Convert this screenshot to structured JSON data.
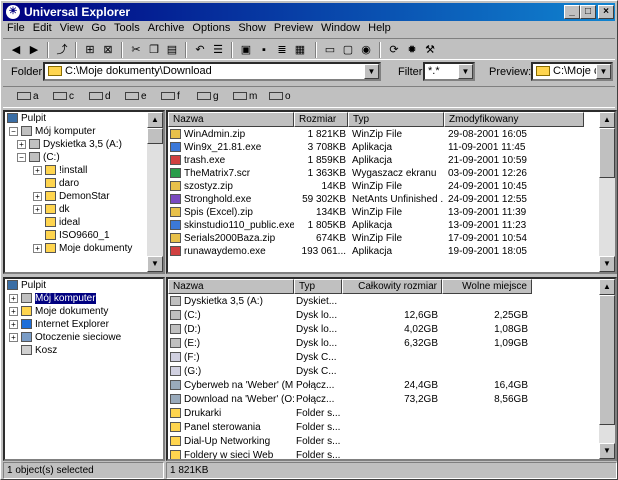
{
  "title": "Universal Explorer",
  "menu": [
    "File",
    "Edit",
    "View",
    "Go",
    "Tools",
    "Archive",
    "Options",
    "Show",
    "Preview",
    "Window",
    "Help"
  ],
  "address": {
    "label": "Folder:",
    "value": "C:\\Moje dokumenty\\Download",
    "filter_label": "Filter:",
    "filter_value": "*.*",
    "preview_label": "Preview:",
    "preview_value": "C:\\Moje do"
  },
  "drives": [
    "a",
    "c",
    "d",
    "e",
    "f",
    "g",
    "m",
    "o"
  ],
  "top_tree": {
    "header": "Pulpit",
    "items": [
      {
        "label": "Mój komputer"
      },
      {
        "label": "Dyskietka 3,5 (A:)"
      },
      {
        "label": "(C:)"
      },
      {
        "label": "!install"
      },
      {
        "label": "daro"
      },
      {
        "label": "DemonStar"
      },
      {
        "label": "dk"
      },
      {
        "label": "ideal"
      },
      {
        "label": "ISO9660_1"
      },
      {
        "label": "Moje dokumenty"
      }
    ]
  },
  "files": {
    "headers": [
      "Nazwa",
      "Rozmiar",
      "Typ",
      "Zmodyfikowany"
    ],
    "rows": [
      {
        "name": "WinAdmin.zip",
        "size": "1 821KB",
        "type": "WinZip File",
        "date": "29-08-2001 16:05"
      },
      {
        "name": "Win9x_21.81.exe",
        "size": "3 708KB",
        "type": "Aplikacja",
        "date": "11-09-2001 11:45"
      },
      {
        "name": "trash.exe",
        "size": "1 859KB",
        "type": "Aplikacja",
        "date": "21-09-2001 10:59"
      },
      {
        "name": "TheMatrix7.scr",
        "size": "1 363KB",
        "type": "Wygaszacz ekranu",
        "date": "03-09-2001 12:26"
      },
      {
        "name": "szostyz.zip",
        "size": "14KB",
        "type": "WinZip File",
        "date": "24-09-2001 10:45"
      },
      {
        "name": "Stronghold.exe",
        "size": "59 302KB",
        "type": "NetAnts Unfinished ...",
        "date": "24-09-2001 12:55"
      },
      {
        "name": "Spis (Excel).zip",
        "size": "134KB",
        "type": "WinZip File",
        "date": "13-09-2001 11:39"
      },
      {
        "name": "skinstudio110_public.exe",
        "size": "1 805KB",
        "type": "Aplikacja",
        "date": "13-09-2001 11:23"
      },
      {
        "name": "Serials2000Baza.zip",
        "size": "674KB",
        "type": "WinZip File",
        "date": "17-09-2001 10:54"
      },
      {
        "name": "runawaydemo.exe",
        "size": "193 061...",
        "type": "Aplikacja",
        "date": "19-09-2001 18:05"
      }
    ]
  },
  "bottom_tree": {
    "header": "Pulpit",
    "items": [
      {
        "label": "Mój komputer"
      },
      {
        "label": "Moje dokumenty"
      },
      {
        "label": "Internet Explorer"
      },
      {
        "label": "Otoczenie sieciowe"
      },
      {
        "label": "Kosz"
      }
    ]
  },
  "drives_list": {
    "headers": [
      "Nazwa",
      "Typ",
      "Całkowity rozmiar",
      "Wolne miejsce"
    ],
    "rows": [
      {
        "name": "Dyskietka 3,5 (A:)",
        "type": "Dyskiet...",
        "total": "",
        "free": ""
      },
      {
        "name": "(C:)",
        "type": "Dysk lo...",
        "total": "12,6GB",
        "free": "2,25GB"
      },
      {
        "name": "(D:)",
        "type": "Dysk lo...",
        "total": "4,02GB",
        "free": "1,08GB"
      },
      {
        "name": "(E:)",
        "type": "Dysk lo...",
        "total": "6,32GB",
        "free": "1,09GB"
      },
      {
        "name": "(F:)",
        "type": "Dysk C...",
        "total": "",
        "free": ""
      },
      {
        "name": "(G:)",
        "type": "Dysk C...",
        "total": "",
        "free": ""
      },
      {
        "name": "Cyberweb na 'Weber' (M:)",
        "type": "Połącz...",
        "total": "24,4GB",
        "free": "16,4GB"
      },
      {
        "name": "Download na 'Weber' (O:)",
        "type": "Połącz...",
        "total": "73,2GB",
        "free": "8,56GB"
      },
      {
        "name": "Drukarki",
        "type": "Folder s...",
        "total": "",
        "free": ""
      },
      {
        "name": "Panel sterowania",
        "type": "Folder s...",
        "total": "",
        "free": ""
      },
      {
        "name": "Dial-Up Networking",
        "type": "Folder s...",
        "total": "",
        "free": ""
      },
      {
        "name": "Foldery w sieci Web",
        "type": "Folder s...",
        "total": "",
        "free": ""
      }
    ]
  },
  "status": {
    "left": "1 object(s) selected",
    "right": "1 821KB"
  }
}
